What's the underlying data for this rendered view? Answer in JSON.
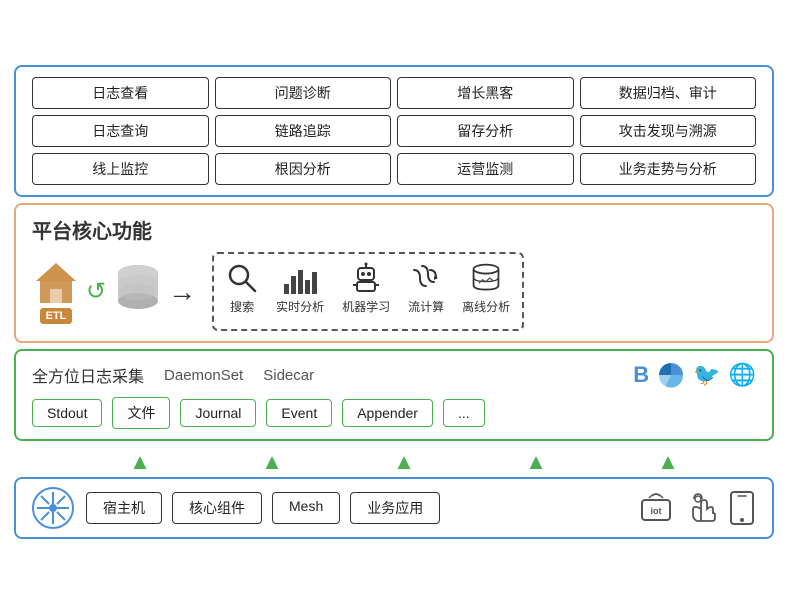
{
  "top": {
    "items": [
      "日志查看",
      "问题诊断",
      "增长黑客",
      "数据归档、审计",
      "日志查询",
      "链路追踪",
      "留存分析",
      "攻击发现与溯源",
      "线上监控",
      "根因分析",
      "运营监测",
      "业务走势与分析"
    ]
  },
  "middle": {
    "title": "平台核心功能",
    "etl_label": "ETL",
    "icons": [
      {
        "label": "搜索"
      },
      {
        "label": "实时分析"
      },
      {
        "label": "机器学习"
      },
      {
        "label": "流计算"
      },
      {
        "label": "离线分析"
      }
    ]
  },
  "collection": {
    "title": "全方位日志采集",
    "subtitle1": "DaemonSet",
    "subtitle2": "Sidecar",
    "items": [
      "Stdout",
      "文件",
      "Journal",
      "Event",
      "Appender",
      "..."
    ]
  },
  "lowest": {
    "items": [
      "宿主机",
      "核心组件",
      "Mesh",
      "业务应用"
    ]
  }
}
